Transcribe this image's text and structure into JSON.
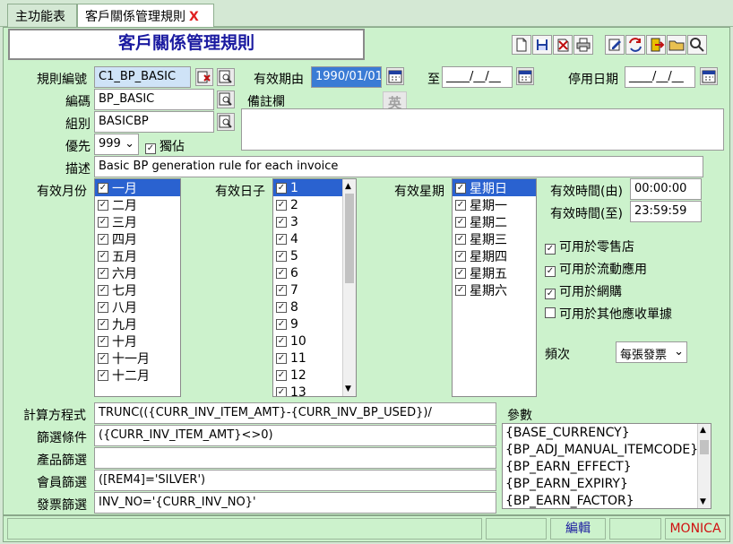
{
  "tabs": {
    "main": "主功能表",
    "active": "客戶關係管理規則",
    "close": "X"
  },
  "title": "客戶關係管理規則",
  "toolbar_icons": [
    "new-icon",
    "save-icon",
    "delete-icon",
    "print-icon",
    "edit-icon",
    "refresh-icon",
    "exit-icon",
    "open-icon",
    "find-icon"
  ],
  "form": {
    "rule_no_label": "規則編號",
    "rule_no_value": "C1_BP_BASIC",
    "valid_from_label": "有效期由",
    "valid_from_value": "1990/01/01",
    "to_label": "至",
    "to_value": "____/__/__",
    "stop_date_label": "停用日期",
    "stop_date_value": "____/__/__",
    "code_label": "編碼",
    "code_value": "BP_BASIC",
    "group_label": "組別",
    "group_value": "BASICBP",
    "priority_label": "優先",
    "priority_value": "999",
    "exclusive_label": "獨佔",
    "ime_badge": "英",
    "remarks_label": "備註欄",
    "desc_label": "描述",
    "desc_value": "Basic BP generation rule for each invoice",
    "month_label": "有效月份",
    "day_label": "有效日子",
    "week_label": "有效星期",
    "time_from_label": "有效時間(由)",
    "time_from_value": "00:00:00",
    "time_to_label": "有效時間(至)",
    "time_to_value": "23:59:59",
    "opt_retail": "可用於零售店",
    "opt_mobile": "可用於流動應用",
    "opt_online": "可用於網購",
    "opt_other": "可用於其他應收單據",
    "freq_label": "頻次",
    "freq_value": "每張發票",
    "formula_label": "計算方程式",
    "formula_value": "TRUNC(({CURR_INV_ITEM_AMT}-{CURR_INV_BP_USED})/",
    "filter_label": "篩選條件",
    "filter_value": "({CURR_INV_ITEM_AMT}<>0)",
    "product_filter_label": "產品篩選",
    "product_filter_value": "",
    "member_filter_label": "會員篩選",
    "member_filter_value": "([REM4]='SILVER')",
    "invoice_filter_label": "發票篩選",
    "invoice_filter_value": "INV_NO='{CURR_INV_NO}'",
    "params_label": "參數"
  },
  "months": [
    "一月",
    "二月",
    "三月",
    "四月",
    "五月",
    "六月",
    "七月",
    "八月",
    "九月",
    "十月",
    "十一月",
    "十二月"
  ],
  "days": [
    "1",
    "2",
    "3",
    "4",
    "5",
    "6",
    "7",
    "8",
    "9",
    "10",
    "11",
    "12",
    "13"
  ],
  "weekdays": [
    "星期日",
    "星期一",
    "星期二",
    "星期三",
    "星期四",
    "星期五",
    "星期六"
  ],
  "params": [
    "{BASE_CURRENCY}",
    "{BP_ADJ_MANUAL_ITEMCODE}",
    "{BP_EARN_EFFECT}",
    "{BP_EARN_EXPIRY}",
    "{BP_EARN_FACTOR}"
  ],
  "status": {
    "mode": "編輯",
    "user": "MONICA"
  }
}
